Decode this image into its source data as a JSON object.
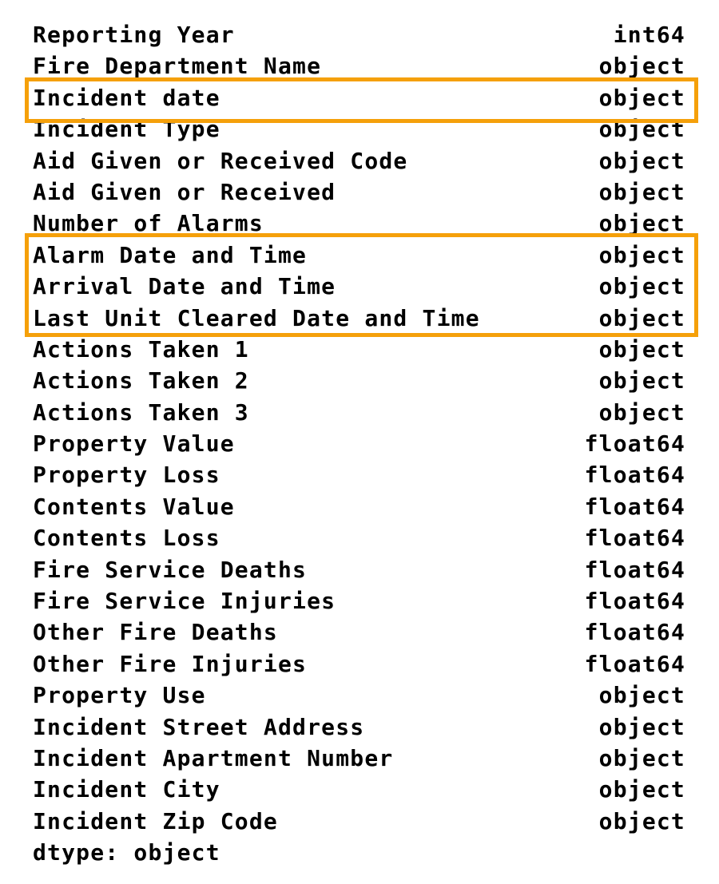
{
  "rows": [
    {
      "name": "Reporting Year",
      "dtype": "int64"
    },
    {
      "name": "Fire Department Name",
      "dtype": "object"
    },
    {
      "name": "Incident date",
      "dtype": "object"
    },
    {
      "name": "Incident Type",
      "dtype": "object"
    },
    {
      "name": "Aid Given or Received Code",
      "dtype": "object"
    },
    {
      "name": "Aid Given or Received",
      "dtype": "object"
    },
    {
      "name": "Number of Alarms",
      "dtype": "object"
    },
    {
      "name": "Alarm Date and Time",
      "dtype": "object"
    },
    {
      "name": "Arrival Date and Time",
      "dtype": "object"
    },
    {
      "name": "Last Unit Cleared Date and Time",
      "dtype": "object"
    },
    {
      "name": "Actions Taken 1",
      "dtype": "object"
    },
    {
      "name": "Actions Taken 2",
      "dtype": "object"
    },
    {
      "name": "Actions Taken 3",
      "dtype": "object"
    },
    {
      "name": "Property Value",
      "dtype": "float64"
    },
    {
      "name": "Property Loss",
      "dtype": "float64"
    },
    {
      "name": "Contents Value",
      "dtype": "float64"
    },
    {
      "name": "Contents Loss",
      "dtype": "float64"
    },
    {
      "name": "Fire Service Deaths",
      "dtype": "float64"
    },
    {
      "name": "Fire Service Injuries",
      "dtype": "float64"
    },
    {
      "name": "Other Fire Deaths",
      "dtype": "float64"
    },
    {
      "name": "Other Fire Injuries",
      "dtype": "float64"
    },
    {
      "name": "Property Use",
      "dtype": "object"
    },
    {
      "name": "Incident Street Address",
      "dtype": "object"
    },
    {
      "name": "Incident Apartment Number",
      "dtype": "object"
    },
    {
      "name": "Incident City",
      "dtype": "object"
    },
    {
      "name": "Incident Zip Code",
      "dtype": "object"
    }
  ],
  "footer": "dtype: object",
  "highlight_color": "#f5a00a",
  "highlighted_groups": [
    [
      "Incident date"
    ],
    [
      "Alarm Date and Time",
      "Arrival Date and Time",
      "Last Unit Cleared Date and Time"
    ]
  ]
}
